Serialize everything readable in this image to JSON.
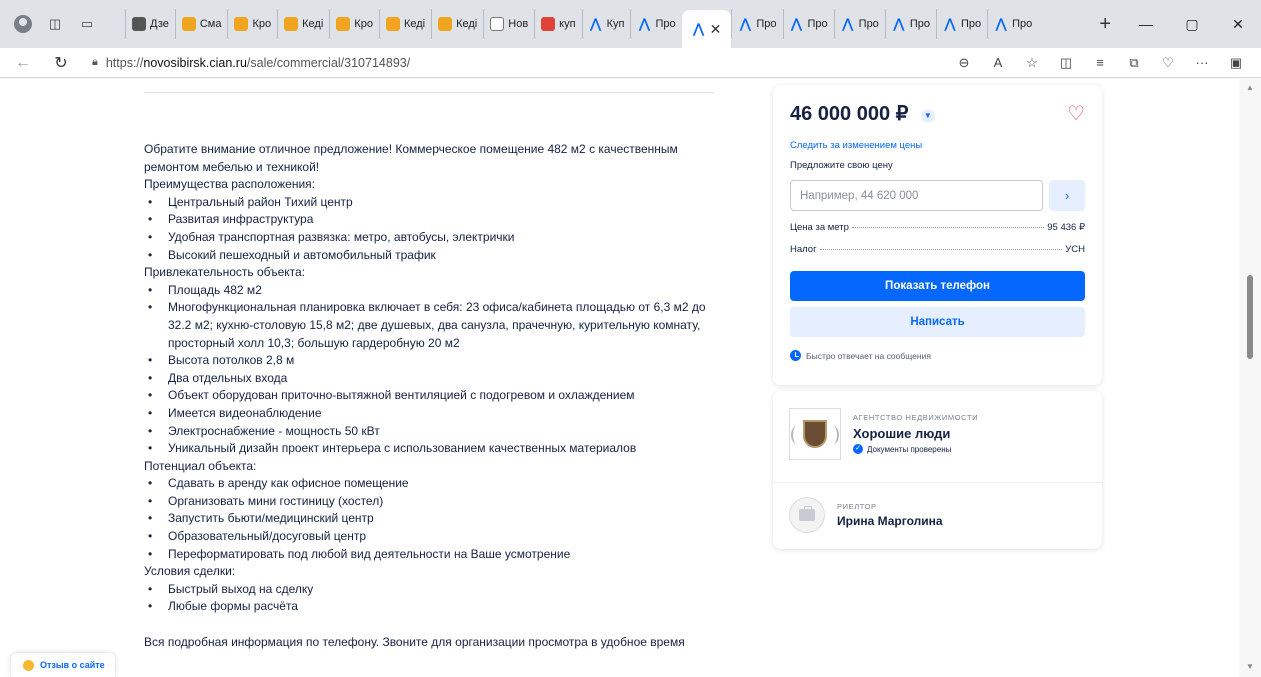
{
  "browser": {
    "tabs": [
      {
        "icon": "dzen-icon",
        "label": "Дзе"
      },
      {
        "icon": "domclick-icon",
        "label": "Смa"
      },
      {
        "icon": "domclick-icon",
        "label": "Кро"
      },
      {
        "icon": "domclick-icon",
        "label": "Кеді"
      },
      {
        "icon": "domclick-icon",
        "label": "Кро"
      },
      {
        "icon": "domclick-icon",
        "label": "Кеді"
      },
      {
        "icon": "domclick-icon",
        "label": "Кеді"
      },
      {
        "icon": "note-icon",
        "label": "Нов"
      },
      {
        "icon": "avito-icon",
        "label": "куп"
      },
      {
        "icon": "cian-icon",
        "label": "Куп"
      },
      {
        "icon": "cian-icon",
        "label": "Про"
      }
    ],
    "tabs_after": [
      {
        "icon": "cian-icon",
        "label": "Про"
      },
      {
        "icon": "cian-icon",
        "label": "Про"
      },
      {
        "icon": "cian-icon",
        "label": "Про"
      },
      {
        "icon": "cian-icon",
        "label": "Про"
      },
      {
        "icon": "cian-icon",
        "label": "Про"
      },
      {
        "icon": "cian-icon",
        "label": "Про"
      }
    ],
    "url_prefix": "https://",
    "url_host": "novosibirsk.cian.ru",
    "url_path": "/sale/commercial/310714893/"
  },
  "description": {
    "intro": "Обратите внимание  отличное предложение! Коммерческое помещение 482 м2 с качественным ремонтом мебелью и техникой!",
    "h1": "Преимущества расположения:",
    "list1": [
      "Центральный район  Тихий центр",
      "Развитая инфраструктура",
      "Удобная транспортная развязка: метро, автобусы, электрички",
      "Высокий пешеходный и автомобильный трафик"
    ],
    "h2": "Привлекательность объекта:",
    "list2": [
      "Площадь 482 м2",
      "Многофункциональная планировка включает в себя: 23 офиса/кабинета площадью от 6,3 м2 до 32.2 м2; кухню-столовую 15,8 м2; две душевых, два санузла, прачечную, курительную комнату, просторный холл 10,3; большую гардеробную 20 м2",
      "Высота потолков 2,8 м",
      "Два отдельных входа",
      "Объект оборудован приточно-вытяжной вентиляцией с подогревом и охлаждением",
      "Имеется видеонаблюдение",
      "Электроснабжение - мощность 50 кВт",
      "Уникальный дизайн проект интерьера с использованием качественных материалов"
    ],
    "h3": "Потенциал объекта:",
    "list3": [
      "Сдавать в аренду как офисное помещение",
      "Организовать мини гостиницу (хостел)",
      "Запустить бьюти/медицинский центр",
      "Образовательный/досуговый центр",
      "Переформатировать под любой вид деятельности на Ваше усмотрение"
    ],
    "h4": "Условия сделки:",
    "list4": [
      "Быстрый выход на сделку",
      "Любые формы расчёта"
    ],
    "outro": "Вся подробная информация по телефону. Звоните для организации просмотра в удобное время"
  },
  "price_card": {
    "price": "46 000 000 ₽",
    "track_link": "Следить за изменением цены",
    "offer_label": "Предложите свою цену",
    "offer_placeholder": "Например, 44 620 000",
    "per_meter_label": "Цена за метр",
    "per_meter_value": "95 436 ₽",
    "tax_label": "Налог",
    "tax_value": "УСН",
    "show_phone": "Показать телефон",
    "write": "Написать",
    "fast_reply": "Быстро отвечает на сообщения"
  },
  "agent_card": {
    "agency_caption": "Агентство недвижимости",
    "agency_name": "Хорошие люди",
    "verified": "Документы проверены",
    "realtor_caption": "Риелтор",
    "realtor_name": "Ирина Марголина"
  },
  "feedback_label": "Отзыв о сайте"
}
